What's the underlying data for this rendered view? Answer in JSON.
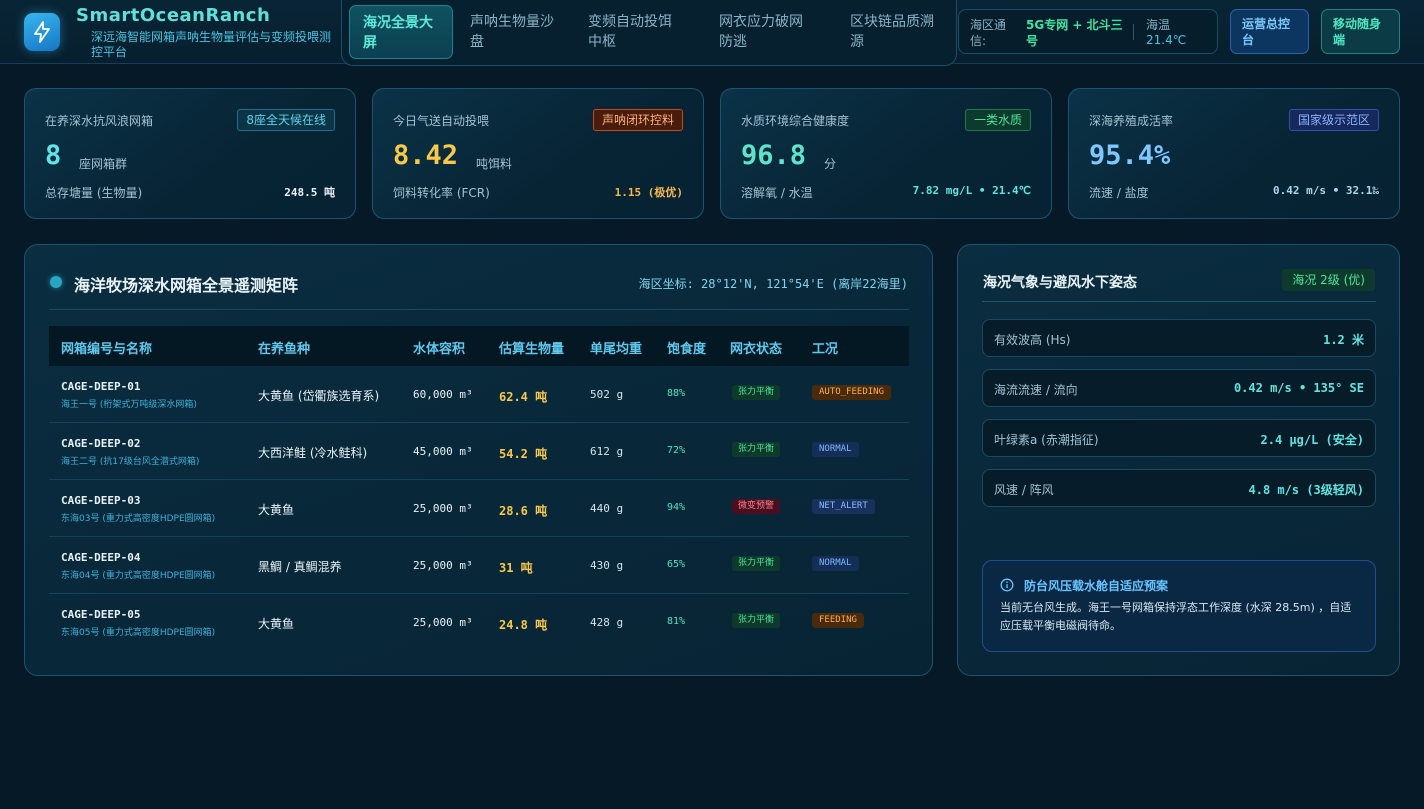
{
  "brand": {
    "title": "SmartOceanRanch",
    "subtitle": "深远海智能网箱声呐生物量评估与变频投喂测控平台"
  },
  "nav": {
    "tabs": [
      {
        "label": "海况全景大屏",
        "active": true
      },
      {
        "label": "声呐生物量沙盘",
        "active": false
      },
      {
        "label": "变频自动投饵中枢",
        "active": false
      },
      {
        "label": "网衣应力破网防逃",
        "active": false
      },
      {
        "label": "区块链品质溯源",
        "active": false
      }
    ]
  },
  "status": {
    "comm_label": "海区通信:",
    "comm_value": "5G专网 + 北斗三号",
    "temp_label": "海温",
    "temp_value": "21.4℃"
  },
  "header_buttons": {
    "ops": "运营总控台",
    "mobile": "移动随身端"
  },
  "kpis": [
    {
      "label": "在养深水抗风浪网箱",
      "badge": "8座全天候在线",
      "value": "8",
      "unit": "座网箱群",
      "foot_label": "总存塘量 (生物量)",
      "foot_value": "248.5 吨"
    },
    {
      "label": "今日气送自动投喂",
      "badge": "声呐闭环控料",
      "value": "8.42",
      "unit": "吨饵料",
      "foot_label": "饲料转化率 (FCR)",
      "foot_value": "1.15 (极优)"
    },
    {
      "label": "水质环境综合健康度",
      "badge": "一类水质",
      "value": "96.8",
      "unit": "分",
      "foot_label": "溶解氧 / 水温",
      "foot_value": "7.82 mg/L • 21.4℃"
    },
    {
      "label": "深海养殖成活率",
      "badge": "国家级示范区",
      "value": "95.4%",
      "unit": "",
      "foot_label": "流速 / 盐度",
      "foot_value": "0.42 m/s • 32.1‰"
    }
  ],
  "matrix": {
    "title": "海洋牧场深水网箱全景遥测矩阵",
    "coord": "海区坐标: 28°12'N, 121°54'E (离岸22海里)",
    "columns": [
      "网箱编号与名称",
      "在养鱼种",
      "水体容积",
      "估算生物量",
      "单尾均重",
      "饱食度",
      "网衣状态",
      "工况"
    ],
    "rows": [
      {
        "id": "CAGE-DEEP-01",
        "name": "海王一号 (桁架式万吨级深水网箱)",
        "species": "大黄鱼 (岱衢族选育系)",
        "volume": "60,000 m³",
        "biomass": "62.4 吨",
        "weight": "502 g",
        "satiety": "88%",
        "net": "张力平衡",
        "net_state": "ok",
        "status": "AUTO_FEEDING",
        "status_type": "feed"
      },
      {
        "id": "CAGE-DEEP-02",
        "name": "海王二号 (抗17级台风全潜式网箱)",
        "species": "大西洋鲑 (冷水鲑科)",
        "volume": "45,000 m³",
        "biomass": "54.2 吨",
        "weight": "612 g",
        "satiety": "72%",
        "net": "张力平衡",
        "net_state": "ok",
        "status": "NORMAL",
        "status_type": "normal"
      },
      {
        "id": "CAGE-DEEP-03",
        "name": "东海03号 (重力式高密度HDPE圆网箱)",
        "species": "大黄鱼",
        "volume": "25,000 m³",
        "biomass": "28.6 吨",
        "weight": "440 g",
        "satiety": "94%",
        "net": "微变预警",
        "net_state": "warn",
        "status": "NET_ALERT",
        "status_type": "alert"
      },
      {
        "id": "CAGE-DEEP-04",
        "name": "东海04号 (重力式高密度HDPE圆网箱)",
        "species": "黑鲷 / 真鲷混养",
        "volume": "25,000 m³",
        "biomass": "31 吨",
        "weight": "430 g",
        "satiety": "65%",
        "net": "张力平衡",
        "net_state": "ok",
        "status": "NORMAL",
        "status_type": "normal"
      },
      {
        "id": "CAGE-DEEP-05",
        "name": "东海05号 (重力式高密度HDPE圆网箱)",
        "species": "大黄鱼",
        "volume": "25,000 m³",
        "biomass": "24.8 吨",
        "weight": "428 g",
        "satiety": "81%",
        "net": "张力平衡",
        "net_state": "ok",
        "status": "FEEDING",
        "status_type": "feed"
      }
    ]
  },
  "side": {
    "title": "海况气象与避风水下姿态",
    "badge": "海况 2级 (优)",
    "metrics": [
      {
        "label": "有效波高 (Hs)",
        "value": "1.2 米"
      },
      {
        "label": "海流流速 / 流向",
        "value": "0.42 m/s • 135° SE"
      },
      {
        "label": "叶绿素a (赤潮指征)",
        "value": "2.4 μg/L (安全)"
      },
      {
        "label": "风速 / 阵风",
        "value": "4.8 m/s (3级轻风)"
      }
    ],
    "alert_title": "防台风压载水舱自适应预案",
    "alert_text": "当前无台风生成。海王一号网箱保持浮态工作深度 (水深 28.5m) ，自适应压载平衡电磁阀待命。"
  },
  "colors": {
    "accent": "#5fe0d8",
    "kpi_values": [
      "#5fe4e8",
      "#f8c84a",
      "#5fe4cc",
      "#7ec8ff"
    ],
    "kpi_badges": [
      {
        "bg": "#0b3446",
        "border": "#1f7090",
        "fg": "#5fd4ec"
      },
      {
        "bg": "#4a1c0c",
        "border": "#c04a1a",
        "fg": "#ffb07a"
      },
      {
        "bg": "#0c3a2c",
        "border": "#1f7a50",
        "fg": "#4ee49a"
      },
      {
        "bg": "#16285c",
        "border": "#3050a8",
        "fg": "#8ab4ff"
      }
    ],
    "kpi_foot_values": [
      "#e8f2f6",
      "#f8b84a",
      "#5fe4e0",
      "#a8d8ec"
    ]
  },
  "icons": {
    "logo": "lightning-bolt-icon",
    "status_dot": "dot-icon",
    "alert": "info-circle-icon"
  }
}
